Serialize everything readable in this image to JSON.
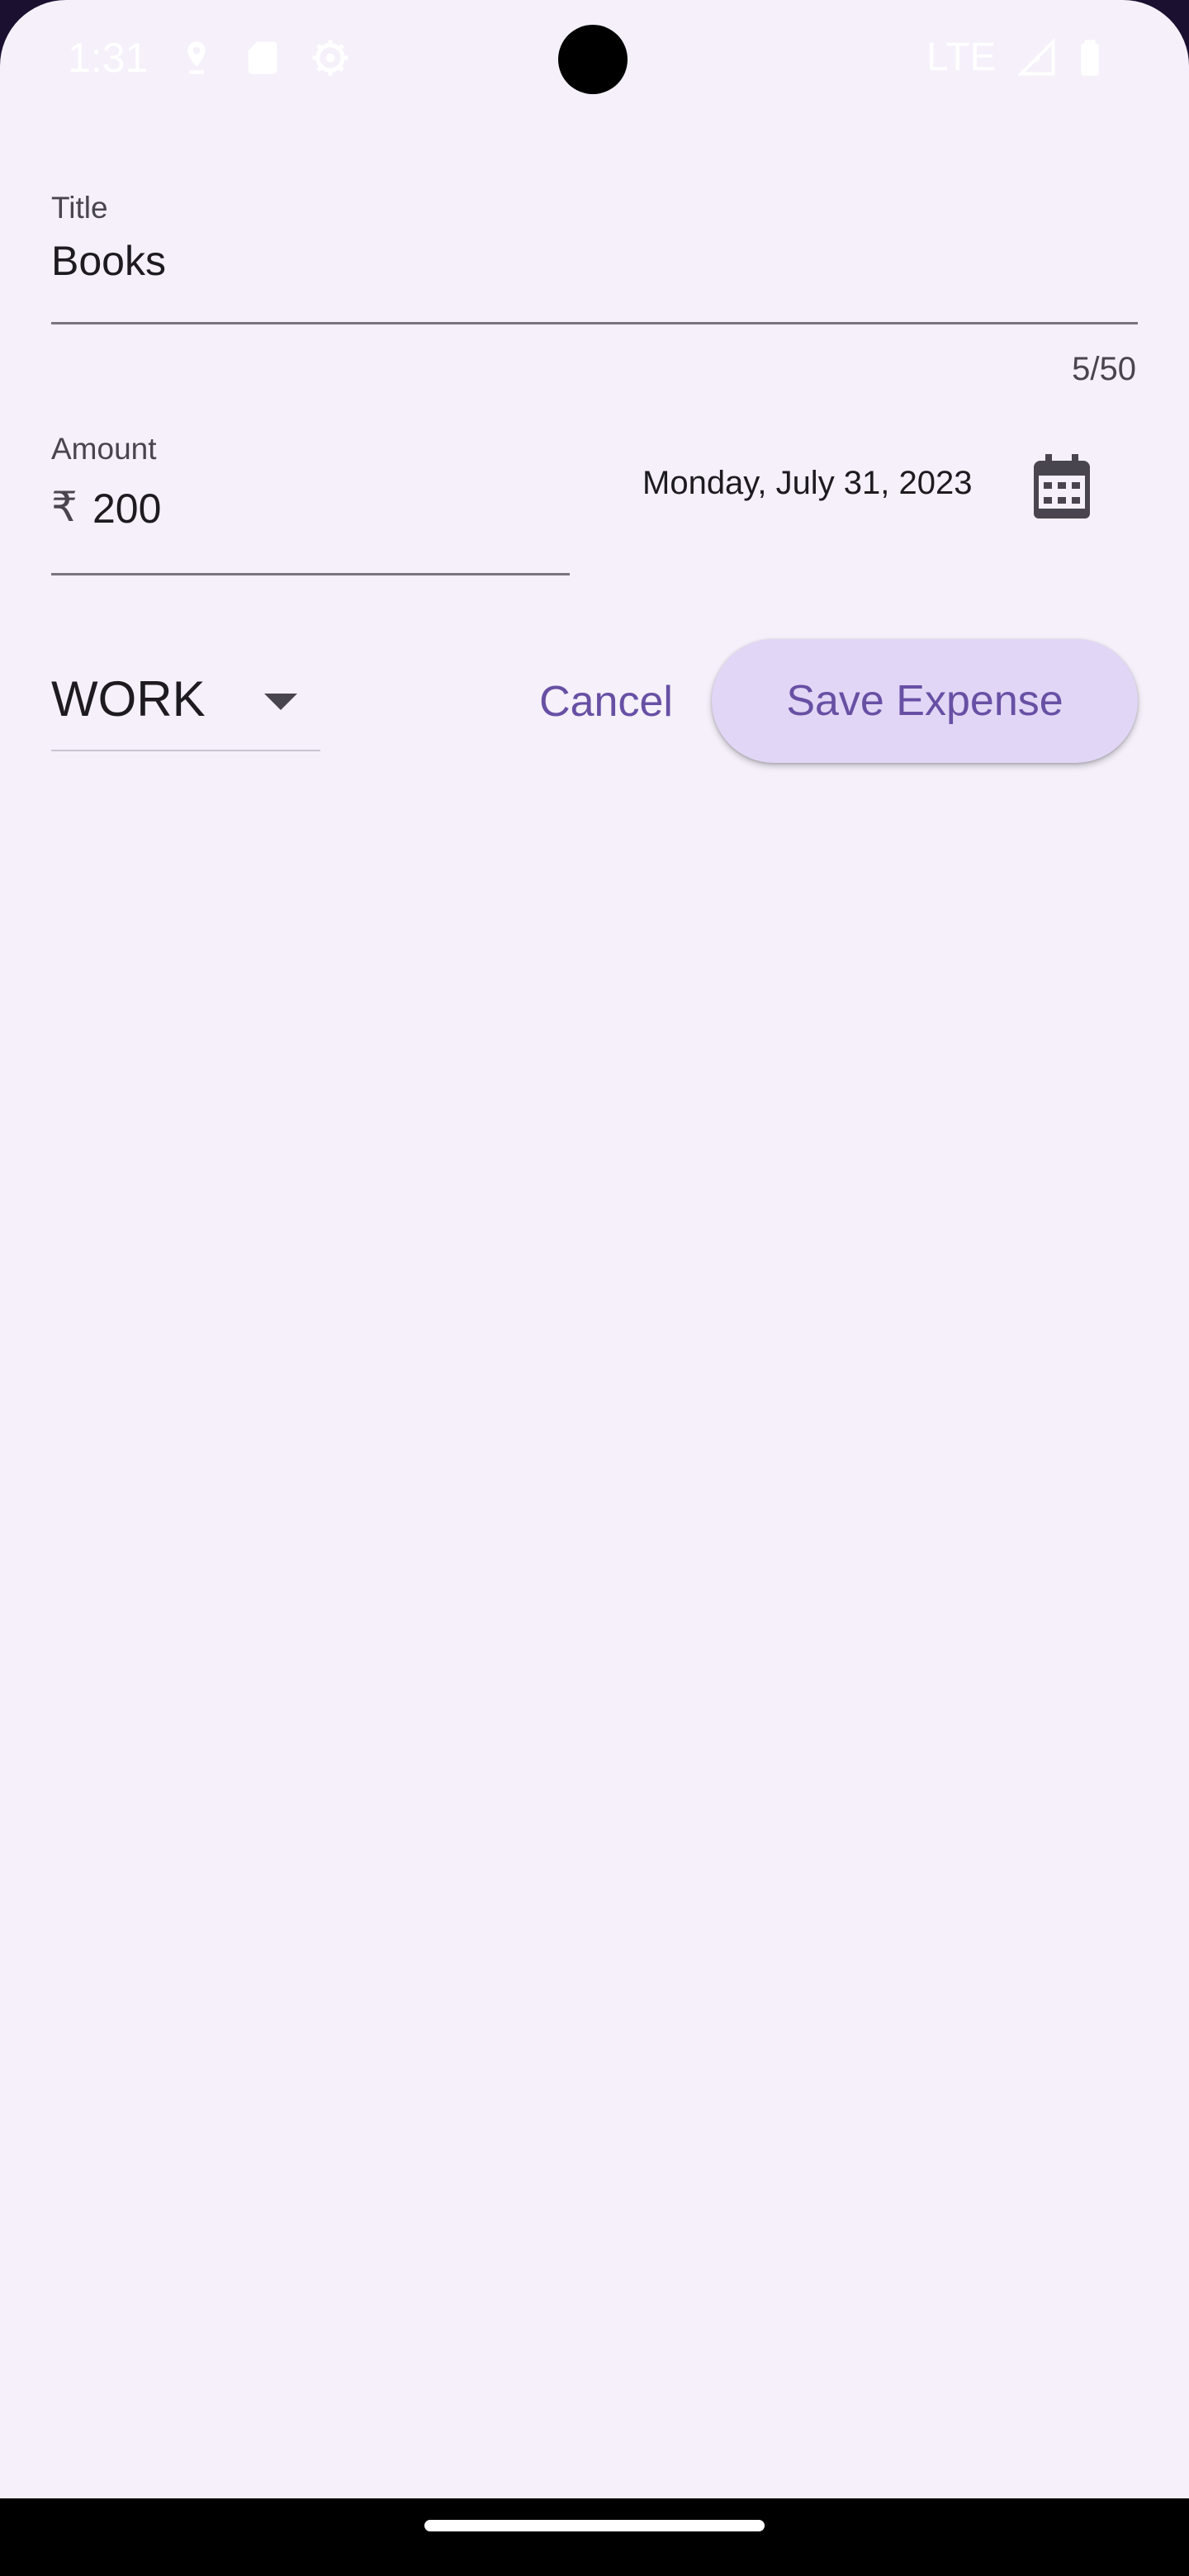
{
  "status_bar": {
    "time": "1:31",
    "network": "LTE",
    "icons": [
      "location-icon",
      "sd-card-icon",
      "settings-gear-icon",
      "signal-icon",
      "battery-icon"
    ]
  },
  "form": {
    "title_label": "Title",
    "title_value": "Books",
    "title_counter": "5/50",
    "amount_label": "Amount",
    "currency_symbol": "₹",
    "amount_value": "200",
    "date": "Monday, July 31, 2023",
    "category": "WORK"
  },
  "actions": {
    "cancel_label": "Cancel",
    "save_label": "Save Expense"
  },
  "colors": {
    "background": "#f5f0fa",
    "accent": "#6750a4",
    "button_fill": "#e2d6f6"
  }
}
